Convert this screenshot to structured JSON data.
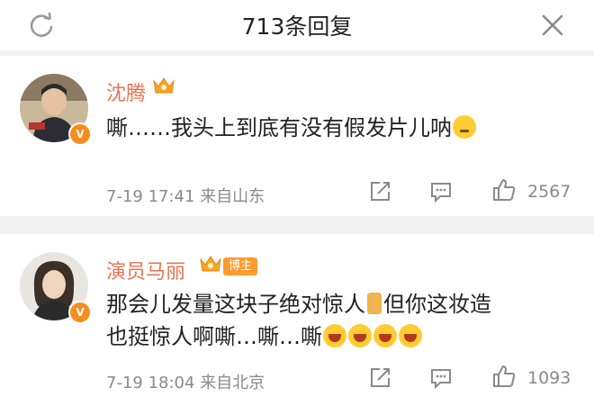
{
  "header": {
    "title": "713条回复"
  },
  "comments": [
    {
      "name": "沈腾",
      "text": "嘶……我头上到底有没有假发片儿呐",
      "emoji": [
        "think-face"
      ],
      "time": "7-19 17:41",
      "source": "来自山东",
      "likes": "2567"
    },
    {
      "name": "演员马丽",
      "tag": "博主",
      "text_line1": "那会儿发量这块子绝对惊人",
      "text_line1b": "但你这妆造",
      "text_line2": "也挺惊人啊嘶…嘶…嘶",
      "emoji": [
        "laugh-face",
        "laugh-face",
        "laugh-face",
        "laugh-face"
      ],
      "time": "7-19 18:04",
      "source": "来自北京",
      "likes": "1093"
    }
  ],
  "colors": {
    "name": "#eb7350",
    "meta": "#8a8a8a",
    "divider": "#f2f2f2",
    "badge": "#f78c1e"
  }
}
